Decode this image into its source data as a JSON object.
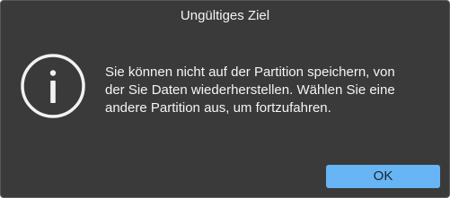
{
  "dialog": {
    "title": "Ungültiges Ziel",
    "icon": "info-icon",
    "message_lines": [
      "Sie können nicht auf der Partition speichern, von",
      "der Sie Daten wiederherstellen. Wählen Sie eine",
      "andere Partition aus, um fortzufahren."
    ],
    "ok_label": "OK"
  },
  "colors": {
    "background": "#3a3a3a",
    "border": "#595959",
    "text": "#f4f4f4",
    "button": "#67b5f4",
    "button_text": "#1c2430"
  }
}
